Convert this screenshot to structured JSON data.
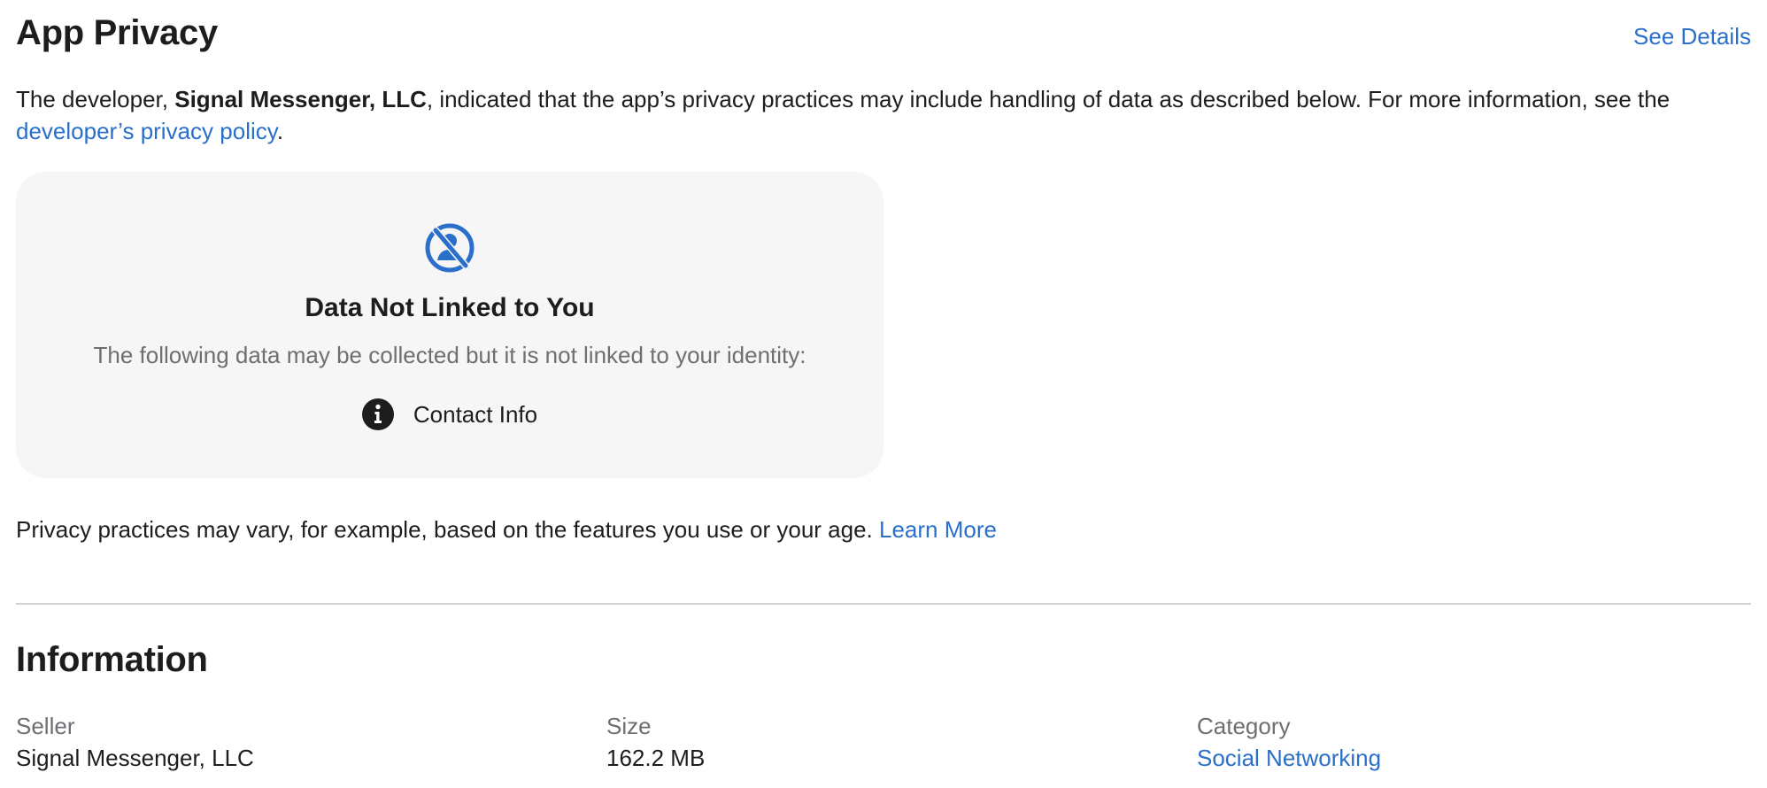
{
  "privacy": {
    "title": "App Privacy",
    "see_details_label": "See Details",
    "description": {
      "prefix": "The developer, ",
      "developer_name": "Signal Messenger, LLC",
      "middle": ", indicated that the app’s privacy practices may include handling of data as described below. For more information, see the ",
      "policy_link": "developer’s privacy policy",
      "suffix": "."
    },
    "card": {
      "icon": "not-linked-icon",
      "title": "Data Not Linked to You",
      "subtitle": "The following data may be collected but it is not linked to your identity:",
      "items": [
        {
          "icon": "info-icon",
          "label": "Contact Info"
        }
      ]
    },
    "footnote": {
      "text": "Privacy practices may vary, for example, based on the features you use or your age. ",
      "learn_more_label": "Learn More"
    }
  },
  "information": {
    "title": "Information",
    "fields": [
      {
        "label": "Seller",
        "value": "Signal Messenger, LLC"
      },
      {
        "label": "Size",
        "value": "162.2 MB"
      },
      {
        "label": "Category",
        "value": "Social Networking"
      }
    ]
  },
  "colors": {
    "link": "#2a6fc9",
    "text": "#1d1d1f",
    "secondary_text": "#6e6e73",
    "card_background": "#f6f6f6",
    "divider": "#d2d2d7"
  }
}
